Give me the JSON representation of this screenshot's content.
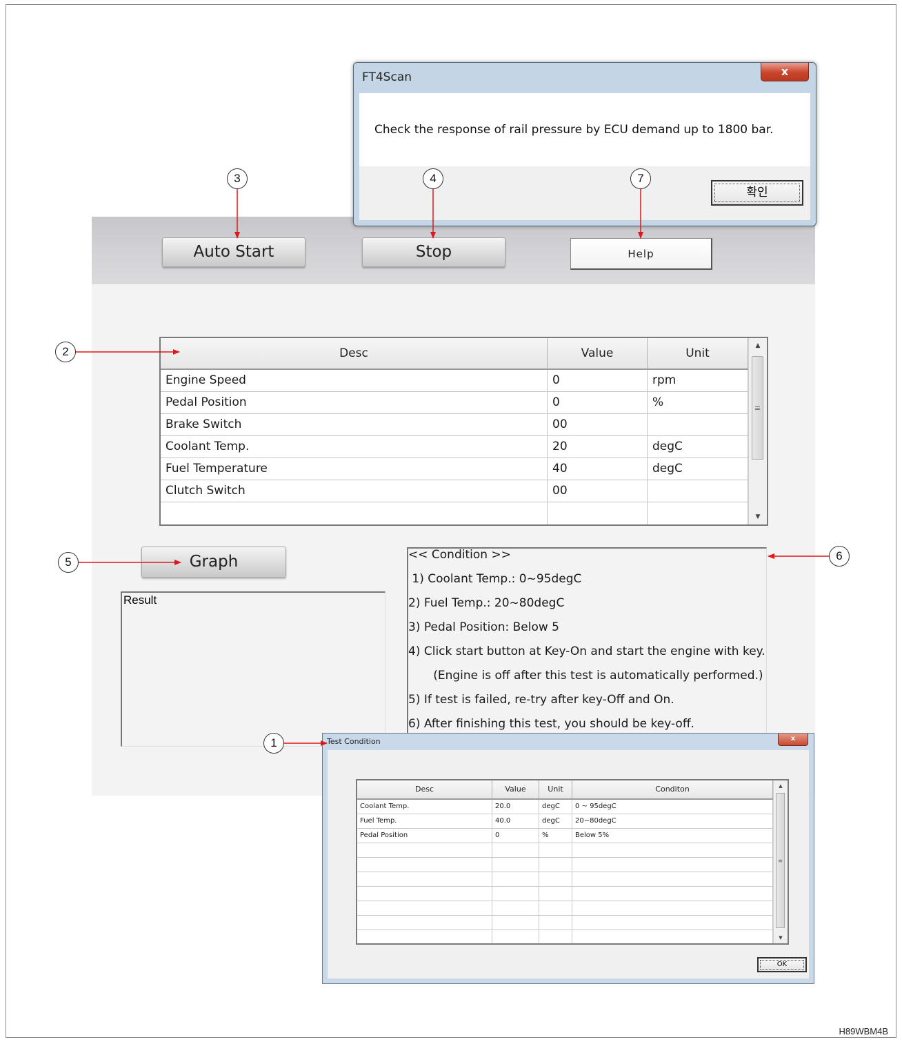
{
  "main": {
    "toolbar": {
      "auto_start": "Auto Start",
      "stop": "Stop",
      "help": "Help"
    },
    "data_table": {
      "headers": [
        "Desc",
        "Value",
        "Unit"
      ],
      "rows": [
        [
          "Engine Speed",
          "0",
          "rpm"
        ],
        [
          "Pedal Position",
          "0",
          "%"
        ],
        [
          "Brake Switch",
          "00",
          ""
        ],
        [
          "Coolant Temp.",
          "20",
          "degC"
        ],
        [
          "Fuel Temperature",
          "40",
          "degC"
        ],
        [
          "Clutch Switch",
          "00",
          ""
        ]
      ]
    },
    "graph_button": "Graph",
    "result_label": "Result",
    "condition_lines": [
      "<< Condition >>",
      " 1) Coolant Temp.: 0~95degC",
      "2) Fuel Temp.: 20~80degC",
      "3) Pedal Position: Below 5",
      "4) Click start button at Key-On and start the engine with key.",
      "   (Engine is off after this test is automatically performed.)",
      "5) If test is failed, re-try after key-Off and On.",
      "6) After finishing this test, you should be key-off."
    ]
  },
  "ft4scan_dialog": {
    "title": "FT4Scan",
    "close": "x",
    "message": "Check the response of rail pressure by ECU demand up to 1800 bar.",
    "ok": "확인"
  },
  "test_condition_dialog": {
    "title": "Test Condition",
    "close": "x",
    "headers": [
      "Desc",
      "Value",
      "Unit",
      "Conditon"
    ],
    "rows": [
      [
        "Coolant Temp.",
        "20.0",
        "degC",
        "0 ~ 95degC"
      ],
      [
        "Fuel Temp.",
        "40.0",
        "degC",
        "20~80degC"
      ],
      [
        "Pedal Position",
        "0",
        "%",
        "Below 5%"
      ]
    ],
    "ok": "OK"
  },
  "callouts": {
    "c1": "1",
    "c2": "2",
    "c3": "3",
    "c4": "4",
    "c5": "5",
    "c6": "6",
    "c7": "7"
  },
  "figure_id": "H89WBM4B",
  "colors": {
    "callout_arrow": "#e0161b",
    "dialog_frame": "#c4d5e6",
    "close_button": "#c9452c"
  }
}
